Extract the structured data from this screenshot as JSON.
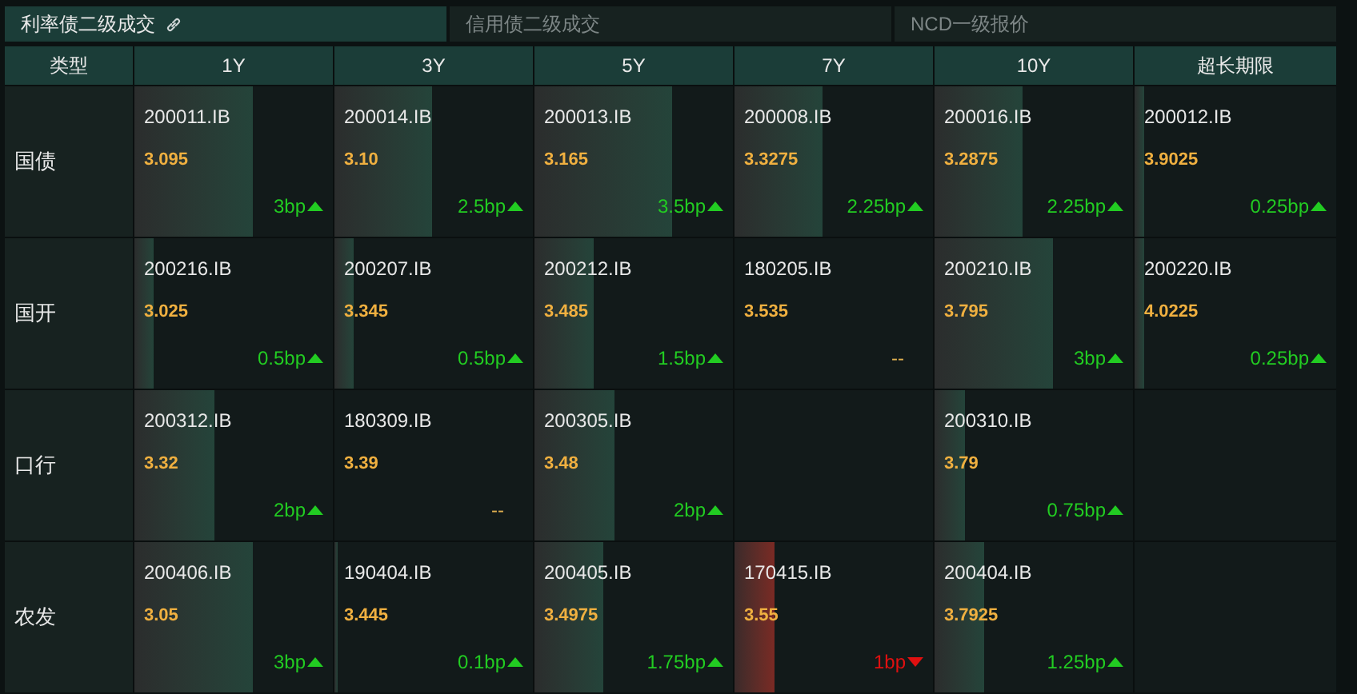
{
  "tabs": [
    {
      "label": "利率债二级成交",
      "selected": true,
      "link_icon": true
    },
    {
      "label": "信用债二级成交",
      "selected": false
    },
    {
      "label": "NCD一级报价",
      "selected": false
    }
  ],
  "table": {
    "type_column": "类型",
    "columns": [
      "1Y",
      "3Y",
      "5Y",
      "7Y",
      "10Y",
      "超长期限"
    ],
    "rows": [
      {
        "type": "国债",
        "cells": [
          {
            "code": "200011.IB",
            "yield": "3.095",
            "change": "3bp",
            "kind": "up",
            "level": 0.6
          },
          {
            "code": "200014.IB",
            "yield": "3.10",
            "change": "2.5bp",
            "kind": "up",
            "level": 0.49
          },
          {
            "code": "200013.IB",
            "yield": "3.165",
            "change": "3.5bp",
            "kind": "up",
            "level": 0.69
          },
          {
            "code": "200008.IB",
            "yield": "3.3275",
            "change": "2.25bp",
            "kind": "up",
            "level": 0.44
          },
          {
            "code": "200016.IB",
            "yield": "3.2875",
            "change": "2.25bp",
            "kind": "up",
            "level": 0.44
          },
          {
            "code": "200012.IB",
            "yield": "3.9025",
            "change": "0.25bp",
            "kind": "up",
            "level": 0.05
          }
        ]
      },
      {
        "type": "国开",
        "cells": [
          {
            "code": "200216.IB",
            "yield": "3.025",
            "change": "0.5bp",
            "kind": "up",
            "level": 0.1
          },
          {
            "code": "200207.IB",
            "yield": "3.345",
            "change": "0.5bp",
            "kind": "up",
            "level": 0.1
          },
          {
            "code": "200212.IB",
            "yield": "3.485",
            "change": "1.5bp",
            "kind": "up",
            "level": 0.3
          },
          {
            "code": "180205.IB",
            "yield": "3.535",
            "change": "--",
            "kind": "flat"
          },
          {
            "code": "200210.IB",
            "yield": "3.795",
            "change": "3bp",
            "kind": "up",
            "level": 0.6
          },
          {
            "code": "200220.IB",
            "yield": "4.0225",
            "change": "0.25bp",
            "kind": "up",
            "level": 0.05
          }
        ]
      },
      {
        "type": "口行",
        "cells": [
          {
            "code": "200312.IB",
            "yield": "3.32",
            "change": "2bp",
            "kind": "up",
            "level": 0.4
          },
          {
            "code": "180309.IB",
            "yield": "3.39",
            "change": "--",
            "kind": "flat"
          },
          {
            "code": "200305.IB",
            "yield": "3.48",
            "change": "2bp",
            "kind": "up",
            "level": 0.4
          },
          null,
          {
            "code": "200310.IB",
            "yield": "3.79",
            "change": "0.75bp",
            "kind": "up",
            "level": 0.15
          },
          null
        ]
      },
      {
        "type": "农发",
        "cells": [
          {
            "code": "200406.IB",
            "yield": "3.05",
            "change": "3bp",
            "kind": "up",
            "level": 0.6
          },
          {
            "code": "190404.IB",
            "yield": "3.445",
            "change": "0.1bp",
            "kind": "up",
            "level": 0.02
          },
          {
            "code": "200405.IB",
            "yield": "3.4975",
            "change": "1.75bp",
            "kind": "up",
            "level": 0.35
          },
          {
            "code": "170415.IB",
            "yield": "3.55",
            "change": "1bp",
            "kind": "down",
            "level": 0.2
          },
          {
            "code": "200404.IB",
            "yield": "3.7925",
            "change": "1.25bp",
            "kind": "up",
            "level": 0.25
          },
          null
        ]
      }
    ]
  }
}
